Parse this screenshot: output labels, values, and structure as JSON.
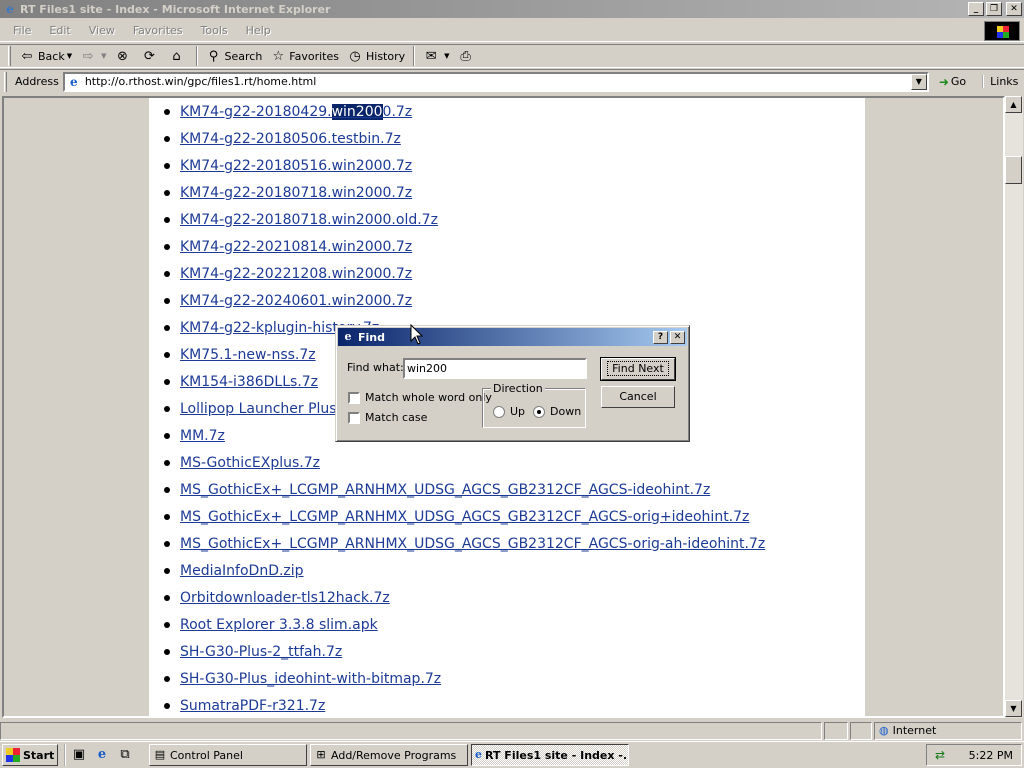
{
  "window": {
    "title": "RT Files1 site - Index - Microsoft Internet Explorer"
  },
  "menu": [
    "File",
    "Edit",
    "View",
    "Favorites",
    "Tools",
    "Help"
  ],
  "toolbar": {
    "back": "Back",
    "search": "Search",
    "favorites": "Favorites",
    "history": "History"
  },
  "address": {
    "label": "Address",
    "url": "http://o.rthost.win/gpc/files1.rt/home.html",
    "go": "Go",
    "links": "Links"
  },
  "files": [
    {
      "before": "KM74-g22-20180429.",
      "hl": "win200",
      "after": "0.7z"
    },
    {
      "before": "KM74-g22-20180506.testbin.7z",
      "hl": "",
      "after": ""
    },
    {
      "before": "KM74-g22-20180516.win2000.7z",
      "hl": "",
      "after": ""
    },
    {
      "before": "KM74-g22-20180718.win2000.7z",
      "hl": "",
      "after": ""
    },
    {
      "before": "KM74-g22-20180718.win2000.old.7z",
      "hl": "",
      "after": ""
    },
    {
      "before": "KM74-g22-20210814.win2000.7z",
      "hl": "",
      "after": ""
    },
    {
      "before": "KM74-g22-20221208.win2000.7z",
      "hl": "",
      "after": ""
    },
    {
      "before": "KM74-g22-20240601.win2000.7z",
      "hl": "",
      "after": ""
    },
    {
      "before": "KM74-g22-kplugin-history.7z",
      "hl": "",
      "after": ""
    },
    {
      "before": "KM75.1-new-nss.7z",
      "hl": "",
      "after": ""
    },
    {
      "before": "KM154-i386DLLs.7z",
      "hl": "",
      "after": ""
    },
    {
      "before": "Lollipop Launcher Plus",
      "hl": "",
      "after": ""
    },
    {
      "before": "MM.7z",
      "hl": "",
      "after": ""
    },
    {
      "before": "MS-GothicEXplus.7z",
      "hl": "",
      "after": ""
    },
    {
      "before": "MS_GothicEx+_LCGMP_ARNHMX_UDSG_AGCS_GB2312CF_AGCS-ideohint.7z",
      "hl": "",
      "after": ""
    },
    {
      "before": "MS_GothicEx+_LCGMP_ARNHMX_UDSG_AGCS_GB2312CF_AGCS-orig+ideohint.7z",
      "hl": "",
      "after": ""
    },
    {
      "before": "MS_GothicEx+_LCGMP_ARNHMX_UDSG_AGCS_GB2312CF_AGCS-orig-ah-ideohint.7z",
      "hl": "",
      "after": ""
    },
    {
      "before": "MediaInfoDnD.zip",
      "hl": "",
      "after": ""
    },
    {
      "before": "Orbitdownloader-tls12hack.7z",
      "hl": "",
      "after": ""
    },
    {
      "before": "Root Explorer 3.3.8 slim.apk",
      "hl": "",
      "after": ""
    },
    {
      "before": "SH-G30-Plus-2_ttfah.7z",
      "hl": "",
      "after": ""
    },
    {
      "before": "SH-G30-Plus_ideohint-with-bitmap.7z",
      "hl": "",
      "after": ""
    },
    {
      "before": "SumatraPDF-r321.7z",
      "hl": "",
      "after": ""
    }
  ],
  "find_dialog": {
    "title": "Find",
    "find_what_label": "Find what:",
    "find_what_value": "win200",
    "match_whole_word": "Match whole word only",
    "match_case": "Match case",
    "direction_label": "Direction",
    "up": "Up",
    "down": "Down",
    "find_next": "Find Next",
    "cancel": "Cancel"
  },
  "status": {
    "zone": "Internet"
  },
  "taskbar": {
    "start": "Start",
    "tasks": [
      "Control Panel",
      "Add/Remove Programs",
      "RT Files1 site - Index -..."
    ],
    "clock": "5:22 PM"
  }
}
